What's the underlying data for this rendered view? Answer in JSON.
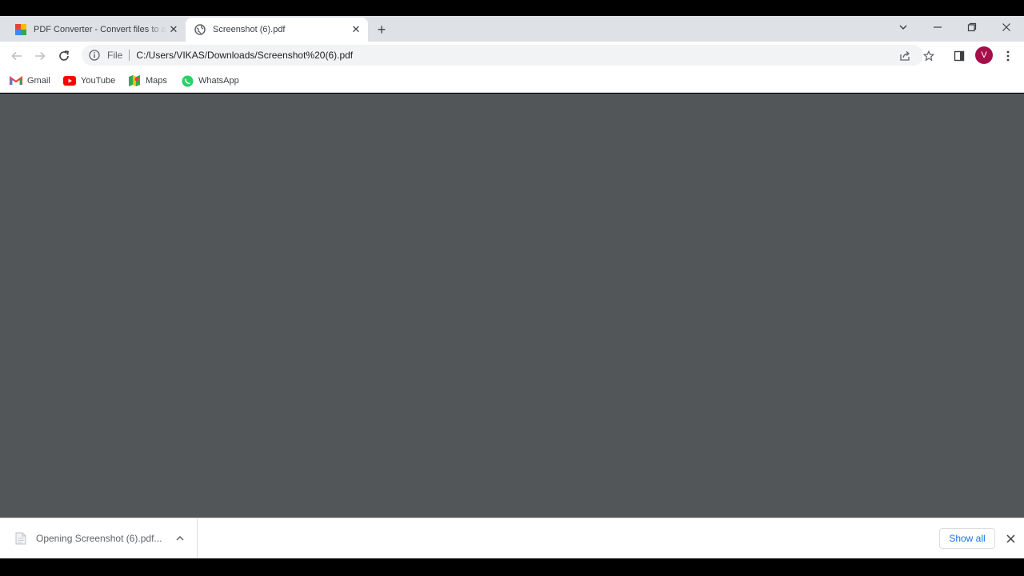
{
  "tabs": [
    {
      "title": "PDF Converter - Convert files to and from PDF",
      "active": false,
      "favicon": "pdf-converter-favicon"
    },
    {
      "title": "Screenshot (6).pdf",
      "active": true,
      "favicon": "globe-icon"
    }
  ],
  "new_tab_label": "+",
  "toolbar": {
    "url_scheme": "File",
    "url": "C:/Users/VIKAS/Downloads/Screenshot%20(6).pdf",
    "avatar_letter": "V"
  },
  "bookmarks": [
    {
      "label": "Gmail",
      "icon": "gmail-icon"
    },
    {
      "label": "YouTube",
      "icon": "youtube-icon"
    },
    {
      "label": "Maps",
      "icon": "maps-icon"
    },
    {
      "label": "WhatsApp",
      "icon": "whatsapp-icon"
    }
  ],
  "download_shelf": {
    "item_text": "Opening Screenshot (6).pdf...",
    "show_all_label": "Show all"
  },
  "colors": {
    "tabstrip": "#dee1e6",
    "viewer_bg": "#525659",
    "avatar": "#a50e4a",
    "link_blue": "#1a73e8"
  }
}
